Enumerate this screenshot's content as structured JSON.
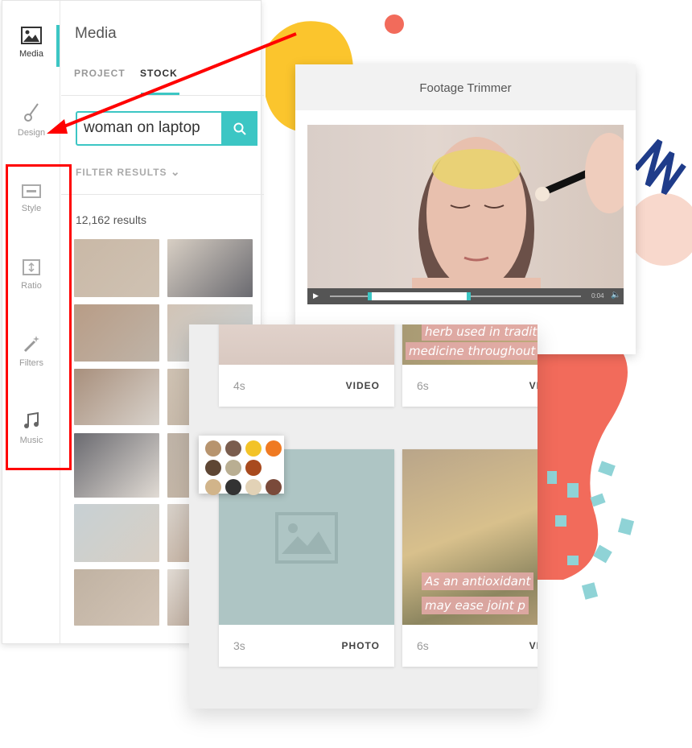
{
  "sidebar": {
    "items": [
      {
        "label": "Media",
        "icon": "image-icon",
        "active": true
      },
      {
        "label": "Design",
        "icon": "paintbrush-icon"
      },
      {
        "label": "Style",
        "icon": "style-icon"
      },
      {
        "label": "Ratio",
        "icon": "ratio-icon"
      },
      {
        "label": "Filters",
        "icon": "magic-wand-icon"
      },
      {
        "label": "Music",
        "icon": "music-note-icon"
      }
    ]
  },
  "media_panel": {
    "title": "Media",
    "tabs": [
      {
        "label": "PROJECT"
      },
      {
        "label": "STOCK",
        "active": true
      }
    ],
    "search": {
      "value": "woman on laptop",
      "icon": "search-icon"
    },
    "filter_label": "FILTER RESULTS",
    "results_count": "12,162 results"
  },
  "trimmer": {
    "title": "Footage Trimmer",
    "time": "0:04",
    "trim_range_percent": [
      15,
      56
    ]
  },
  "timeline": {
    "cards": [
      {
        "duration": "4s",
        "type": "VIDEO"
      },
      {
        "duration": "6s",
        "type": "VIDEO",
        "caption": [
          "herb used in tradition",
          "medicine throughout"
        ]
      },
      {
        "duration": "3s",
        "type": "PHOTO"
      },
      {
        "duration": "6s",
        "type": "VIDEO",
        "caption": [
          "As an antioxidant",
          "may ease joint p"
        ]
      }
    ]
  },
  "colors": {
    "accent": "#3cc6c4",
    "annotation": "#ff0000",
    "coral": "#f26b5b",
    "yellow": "#fbc52d"
  }
}
